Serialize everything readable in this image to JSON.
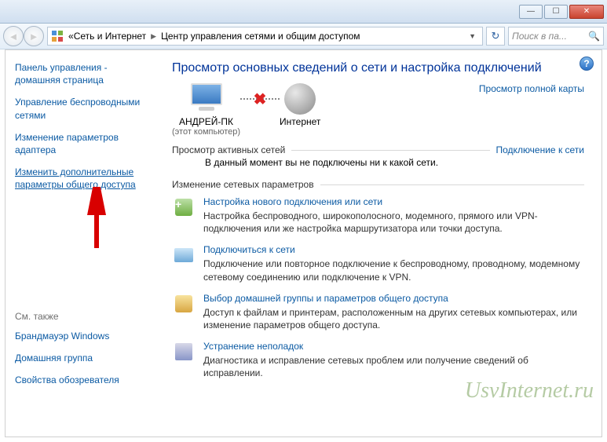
{
  "titlebar": {
    "min": "—",
    "max": "☐",
    "close": "✕"
  },
  "nav": {
    "crumb1": "Сеть и Интернет",
    "crumb2": "Центр управления сетями и общим доступом",
    "search_placeholder": "Поиск в па..."
  },
  "sidebar": {
    "home": "Панель управления - домашняя страница",
    "wireless": "Управление беспроводными сетями",
    "adapter": "Изменение параметров адаптера",
    "sharing": "Изменить дополнительные параметры общего доступа",
    "see_also": "См. также",
    "firewall": "Брандмауэр Windows",
    "homegroup": "Домашняя группа",
    "inetopts": "Свойства обозревателя"
  },
  "main": {
    "heading": "Просмотр основных сведений о сети и настройка подключений",
    "full_map": "Просмотр полной карты",
    "pc_name": "АНДРЕЙ-ПК",
    "pc_sub": "(этот компьютер)",
    "internet": "Интернет",
    "active_title": "Просмотр активных сетей",
    "connect_link": "Подключение к сети",
    "not_connected": "В данный момент вы не подключены ни к какой сети.",
    "change_title": "Изменение сетевых параметров",
    "items": [
      {
        "title": "Настройка нового подключения или сети",
        "desc": "Настройка беспроводного, широкополосного, модемного, прямого или VPN-подключения или же настройка маршрутизатора или точки доступа."
      },
      {
        "title": "Подключиться к сети",
        "desc": "Подключение или повторное подключение к беспроводному, проводному, модемному сетевому соединению или подключение к VPN."
      },
      {
        "title": "Выбор домашней группы и параметров общего доступа",
        "desc": "Доступ к файлам и принтерам, расположенным на других сетевых компьютерах, или изменение параметров общего доступа."
      },
      {
        "title": "Устранение неполадок",
        "desc": "Диагностика и исправление сетевых проблем или получение сведений об исправлении."
      }
    ]
  },
  "watermark": "UsvInternet.ru"
}
